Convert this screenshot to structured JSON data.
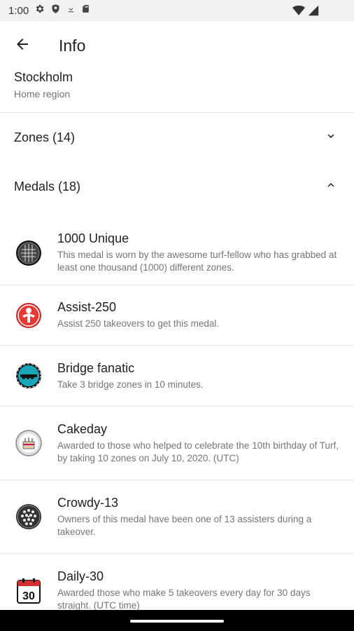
{
  "status_bar": {
    "time": "1:00",
    "icons": [
      "gear-icon",
      "shield-icon",
      "download-icon",
      "sd-card-icon",
      "wifi-icon",
      "signal-icon"
    ]
  },
  "app_bar": {
    "title": "Info",
    "back_icon": "arrow-left-icon"
  },
  "region": {
    "name": "Stockholm",
    "label": "Home region"
  },
  "sections": {
    "zones": {
      "label": "Zones (14)",
      "icon": "chevron-down-icon"
    },
    "medals": {
      "label": "Medals (18)",
      "icon": "chevron-up-icon"
    }
  },
  "medals": [
    {
      "title": "1000 Unique",
      "desc": "This medal is worn by the awesome turf-fellow who has grabbed at least one thousand (1000) different zones.",
      "icon": "unique-medal-icon"
    },
    {
      "title": "Assist-250",
      "desc": "Assist 250 takeovers to get this medal.",
      "icon": "assist-medal-icon"
    },
    {
      "title": "Bridge fanatic",
      "desc": "Take 3 bridge zones in 10 minutes.",
      "icon": "bridge-medal-icon"
    },
    {
      "title": "Cakeday",
      "desc": "Awarded to those who helped to celebrate the 10th birthday of Turf, by taking 10 zones on July 10, 2020. (UTC)",
      "icon": "cake-medal-icon"
    },
    {
      "title": "Crowdy-13",
      "desc": "Owners of this medal have been one of 13 assisters during a takeover.",
      "icon": "crowdy-medal-icon"
    },
    {
      "title": "Daily-30",
      "desc": "Awarded those who make 5 takeovers every day for 30 days straight. (UTC time)",
      "icon": "calendar-30-medal-icon",
      "icon_text": "30"
    }
  ],
  "colors": {
    "accent_red": "#d32f2f",
    "teal": "#1aa6b7",
    "divider": "#e8e8e8"
  }
}
